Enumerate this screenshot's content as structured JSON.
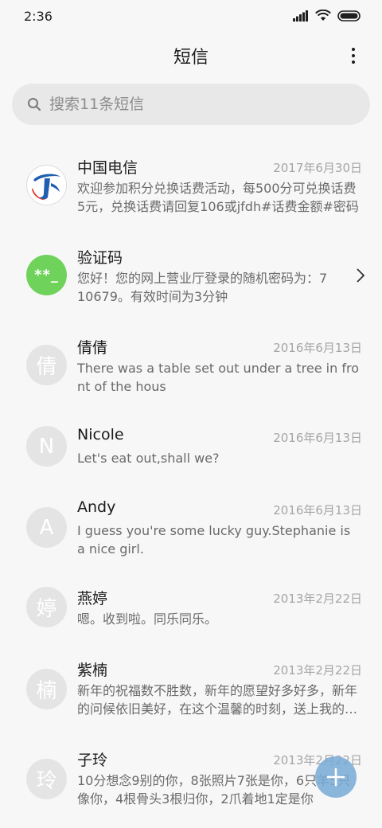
{
  "status_bar": {
    "time": "2:36"
  },
  "header": {
    "title": "短信"
  },
  "search": {
    "placeholder": "搜索11条短信"
  },
  "conversations": [
    {
      "name": "中国电信",
      "date": "2017年6月30日",
      "preview": "欢迎参加积分兑换话费活动，每500分可兑换话费5元，兑换话费请回复106或jfdh#话费金额#密码",
      "avatar_type": "logo"
    },
    {
      "name": "验证码",
      "date": "",
      "preview": "您好！您的网上营业厅登录的随机密码为：710679。有效时间为3分钟",
      "avatar_type": "green",
      "avatar_text": "**_"
    },
    {
      "name": "倩倩",
      "date": "2016年6月13日",
      "preview": "There was a table set out under a tree in front of the hous",
      "avatar_text": "倩"
    },
    {
      "name": "Nicole",
      "date": "2016年6月13日",
      "preview": "Let's eat out,shall we?",
      "avatar_text": "N"
    },
    {
      "name": "Andy",
      "date": "2016年6月13日",
      "preview": "I guess you're some lucky guy.Stephanie is a nice girl.",
      "avatar_text": "A"
    },
    {
      "name": "燕婷",
      "date": "2013年2月22日",
      "preview": "嗯。收到啦。同乐同乐。",
      "avatar_text": "婷"
    },
    {
      "name": "紫楠",
      "date": "2013年2月22日",
      "preview": "新年的祝福数不胜数，新年的愿望好多好多，新年的问候依旧美好，在这个温馨的时刻，送上我的祝福",
      "avatar_text": "楠"
    },
    {
      "name": "子玲",
      "date": "2013年2月22日",
      "preview": "10分想念9别的你，8张照片7张是你，6只羊5只像你，4根骨头3根归你，2爪着地1定是你",
      "avatar_text": "玲"
    }
  ],
  "colors": {
    "background": "#f7f7f7",
    "search_bg": "#e8e8e8",
    "green_avatar": "#6fd25a",
    "fab": "#7aaad7"
  }
}
